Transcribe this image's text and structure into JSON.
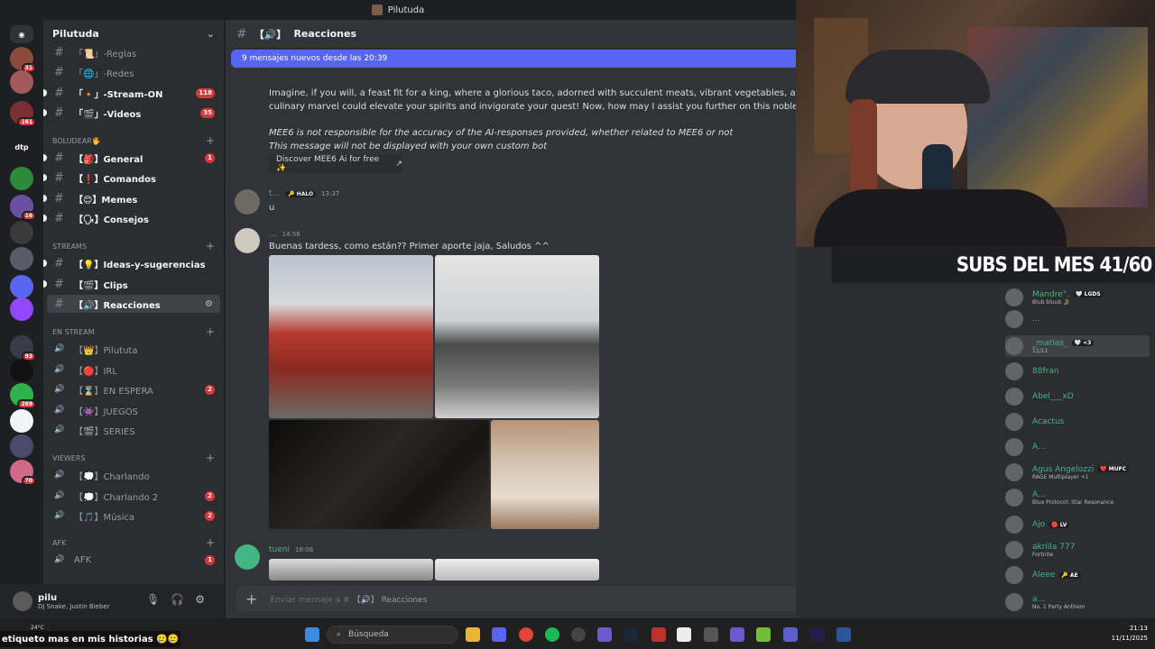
{
  "window": {
    "title": "Pilutuda"
  },
  "sidebar": {
    "server_name": "Pilutuda",
    "channels": [
      {
        "name": "「📜」-Reglas",
        "badge": "",
        "bold": false
      },
      {
        "name": "「🌐」-Redes",
        "badge": "",
        "bold": false
      },
      {
        "name": "「🔸」-Stream-ON",
        "badge": "118",
        "bold": true
      },
      {
        "name": "「🎬」-Videos",
        "badge": "35",
        "bold": true
      }
    ],
    "cat_boludear": "BOLUDEAR🖐",
    "boludear": [
      {
        "name": "【🎒】General",
        "badge": "1",
        "bold": true
      },
      {
        "name": "【❗】Comandos",
        "badge": "",
        "bold": true
      },
      {
        "name": "【😊】Memes",
        "badge": "",
        "bold": true
      },
      {
        "name": "【🗣】Consejos",
        "badge": "",
        "bold": true
      }
    ],
    "cat_streams": "STREAMS",
    "streams": [
      {
        "name": "【💡】Ideas-y-sugerencias",
        "badge": "",
        "bold": true
      },
      {
        "name": "【🎬】Clips",
        "badge": "",
        "bold": true
      },
      {
        "name": "【🔊】Reacciones",
        "badge": "",
        "bold": true
      }
    ],
    "cat_en_stream": "EN STREAM",
    "en_stream": [
      {
        "name": "【👑】Pilututa",
        "badge": ""
      },
      {
        "name": "【🔴】IRL",
        "badge": ""
      },
      {
        "name": "【⌛】EN ESPERA",
        "badge": "2"
      },
      {
        "name": "【👾】JUEGOS",
        "badge": ""
      },
      {
        "name": "【🎬】SERIES",
        "badge": ""
      }
    ],
    "cat_viewers": "VIEWERS",
    "viewers": [
      {
        "name": "【💭】Charlando",
        "badge": ""
      },
      {
        "name": "【💭】Charlando 2",
        "badge": "2"
      },
      {
        "name": "【🎵】Música",
        "badge": "2"
      }
    ],
    "cat_afk": "AFK",
    "afk": [
      {
        "name": "AFK",
        "badge": "1"
      }
    ]
  },
  "servers": [
    {
      "label": "",
      "badge": "31",
      "color": "#8a4b3c"
    },
    {
      "label": "",
      "badge": "",
      "color": "#a05a5a"
    },
    {
      "label": "",
      "badge": "161",
      "color": "#7a3030"
    },
    {
      "label": "dtp",
      "badge": "",
      "color": "#1e1f22"
    },
    {
      "label": "",
      "badge": "",
      "color": "#2d8a3a"
    },
    {
      "label": "",
      "badge": "16",
      "color": "#6b4fa0"
    },
    {
      "label": "",
      "badge": "",
      "color": "#3a3a3a"
    },
    {
      "label": "",
      "badge": "",
      "color": "#5a5a6a"
    },
    {
      "label": "",
      "badge": "",
      "color": "#5865f2"
    },
    {
      "label": "",
      "badge": "",
      "color": "#9146ff"
    },
    {
      "label": "",
      "badge": "93",
      "color": "#3a3a4a"
    },
    {
      "label": "",
      "badge": "",
      "color": "#111"
    },
    {
      "label": "",
      "badge": "269",
      "color": "#2db34a"
    },
    {
      "label": "",
      "badge": "",
      "color": "#f2f3f5"
    },
    {
      "label": "",
      "badge": "",
      "color": "#4a4a6a"
    },
    {
      "label": "",
      "badge": "70",
      "color": "#d06a8a"
    }
  ],
  "user": {
    "name": "pilu",
    "status": "DJ Snake, Justin Bieber"
  },
  "channel_header": {
    "icon": "【🔊】",
    "name": "Reacciones"
  },
  "new_messages_bar": "9 mensajes nuevos desde las 20:39",
  "messages": {
    "bot_line1": "Imagine, if you will, a feast fit for a king, where a glorious taco, adorned with succulent meats, vibrant vegetables, and a cascade of",
    "bot_line2": "culinary marvel could elevate your spirits and invigorate your quest! Now, how may I assist you further on this noble journey?",
    "bot_disclaimer1": "MEE6 is not responsible for the accuracy of the AI-responses provided, whether related to MEE6 or not",
    "bot_disclaimer2": "This message will not be displayed with your own custom bot",
    "discover_button": "Discover MEE6 Ai for free ✨",
    "msg2_user": "t...",
    "msg2_tag": "🔑 HALO",
    "msg2_time": "13:37",
    "msg2_text": "u",
    "msg3_user": "...",
    "msg3_time": "14:56",
    "msg3_text": "Buenas tardess, como están?? Primer aporte jaja, Saludos ^^",
    "msg4_user": "tueni",
    "msg4_time": "18:06"
  },
  "composer": {
    "placeholder_prefix": "Enviar mensaje a #",
    "channel": "【🔊】 Reacciones"
  },
  "overlay": {
    "subs": "SUBS DEL MES 41/60"
  },
  "members": [
    {
      "name": "Mandre°.",
      "tag": "🤍 LGDS",
      "status": "Blub bluub 🐊"
    },
    {
      "name": "...",
      "tag": "",
      "status": ""
    },
    {
      "name": "_matías_",
      "tag": "🤍 <3",
      "status": "11/11"
    },
    {
      "name": "88fran",
      "tag": "",
      "status": ""
    },
    {
      "name": "Abel___xD",
      "tag": "",
      "status": ""
    },
    {
      "name": "Acactus",
      "tag": "",
      "status": ""
    },
    {
      "name": "A...",
      "tag": "",
      "status": ""
    },
    {
      "name": "Agus Angelozzi",
      "tag": "❤️ MUFC",
      "status": "RAGE Multiplayer +1"
    },
    {
      "name": "A...",
      "tag": "",
      "status": "Blue Protocol: Star Resonance"
    },
    {
      "name": "Ajo",
      "tag": "🔴 LV",
      "status": ""
    },
    {
      "name": "akriila 777",
      "tag": "",
      "status": "Fortnite"
    },
    {
      "name": "Aleee",
      "tag": "🔑 AE",
      "status": ""
    },
    {
      "name": "a...",
      "tag": "",
      "status": "No. 1 Party Anthem"
    }
  ],
  "taskbar": {
    "ticker": "etiqueto mas en mis historias 🥲🥲",
    "weather": "24°C",
    "search_placeholder": "Búsqueda",
    "time": "21:13",
    "date": "11/11/2025"
  }
}
